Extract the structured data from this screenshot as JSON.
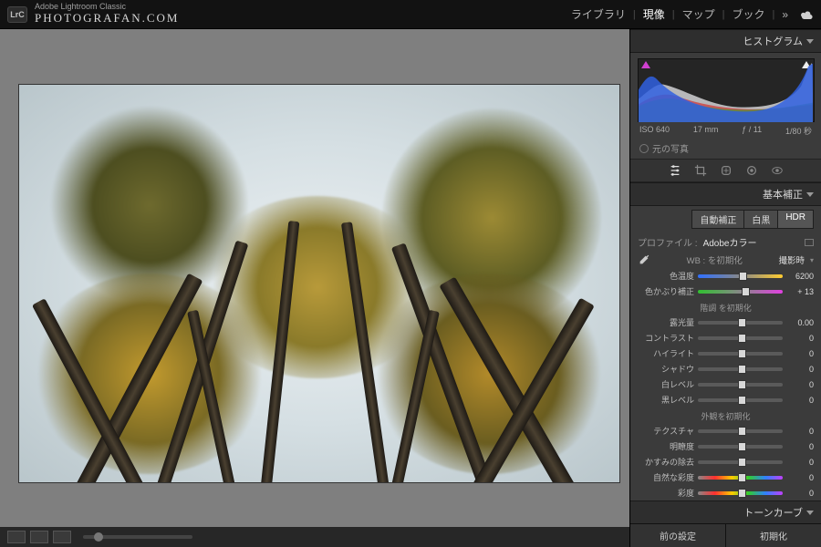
{
  "app": {
    "subtitle": "Adobe Lightroom Classic",
    "brand": "PHOTOGRAFAN.COM",
    "logo": "LrC"
  },
  "topnav": {
    "library": "ライブラリ",
    "develop": "現像",
    "map": "マップ",
    "book": "ブック",
    "more": "»"
  },
  "hist": {
    "title": "ヒストグラム",
    "iso": "ISO 640",
    "focal": "17 mm",
    "aperture": "ƒ / 11",
    "shutter": "1/80 秒",
    "original": "元の写真"
  },
  "panel": {
    "basic": "基本補正",
    "auto": "自動補正",
    "bw": "白黒",
    "hdr": "HDR",
    "profile_label": "プロファイル :",
    "profile_value": "Adobeカラー",
    "wb_reset": "WB : を初期化",
    "wb_asshot": "撮影時",
    "temp": {
      "label": "色温度",
      "value": "6200"
    },
    "tint": {
      "label": "色かぶり補正",
      "value": "+ 13"
    },
    "tone_reset": "階調 を初期化",
    "exposure": {
      "label": "露光量",
      "value": "0.00"
    },
    "contrast": {
      "label": "コントラスト",
      "value": "0"
    },
    "highlights": {
      "label": "ハイライト",
      "value": "0"
    },
    "shadows": {
      "label": "シャドウ",
      "value": "0"
    },
    "whites": {
      "label": "白レベル",
      "value": "0"
    },
    "blacks": {
      "label": "黒レベル",
      "value": "0"
    },
    "presence_reset": "外観を初期化",
    "texture": {
      "label": "テクスチャ",
      "value": "0"
    },
    "clarity": {
      "label": "明瞭度",
      "value": "0"
    },
    "dehaze": {
      "label": "かすみの除去",
      "value": "0"
    },
    "vibrance": {
      "label": "自然な彩度",
      "value": "0"
    },
    "saturation": {
      "label": "彩度",
      "value": "0"
    },
    "tonecurve": "トーンカーブ",
    "initial": "初期"
  },
  "footer": {
    "prev": "前の設定",
    "reset": "初期化"
  }
}
